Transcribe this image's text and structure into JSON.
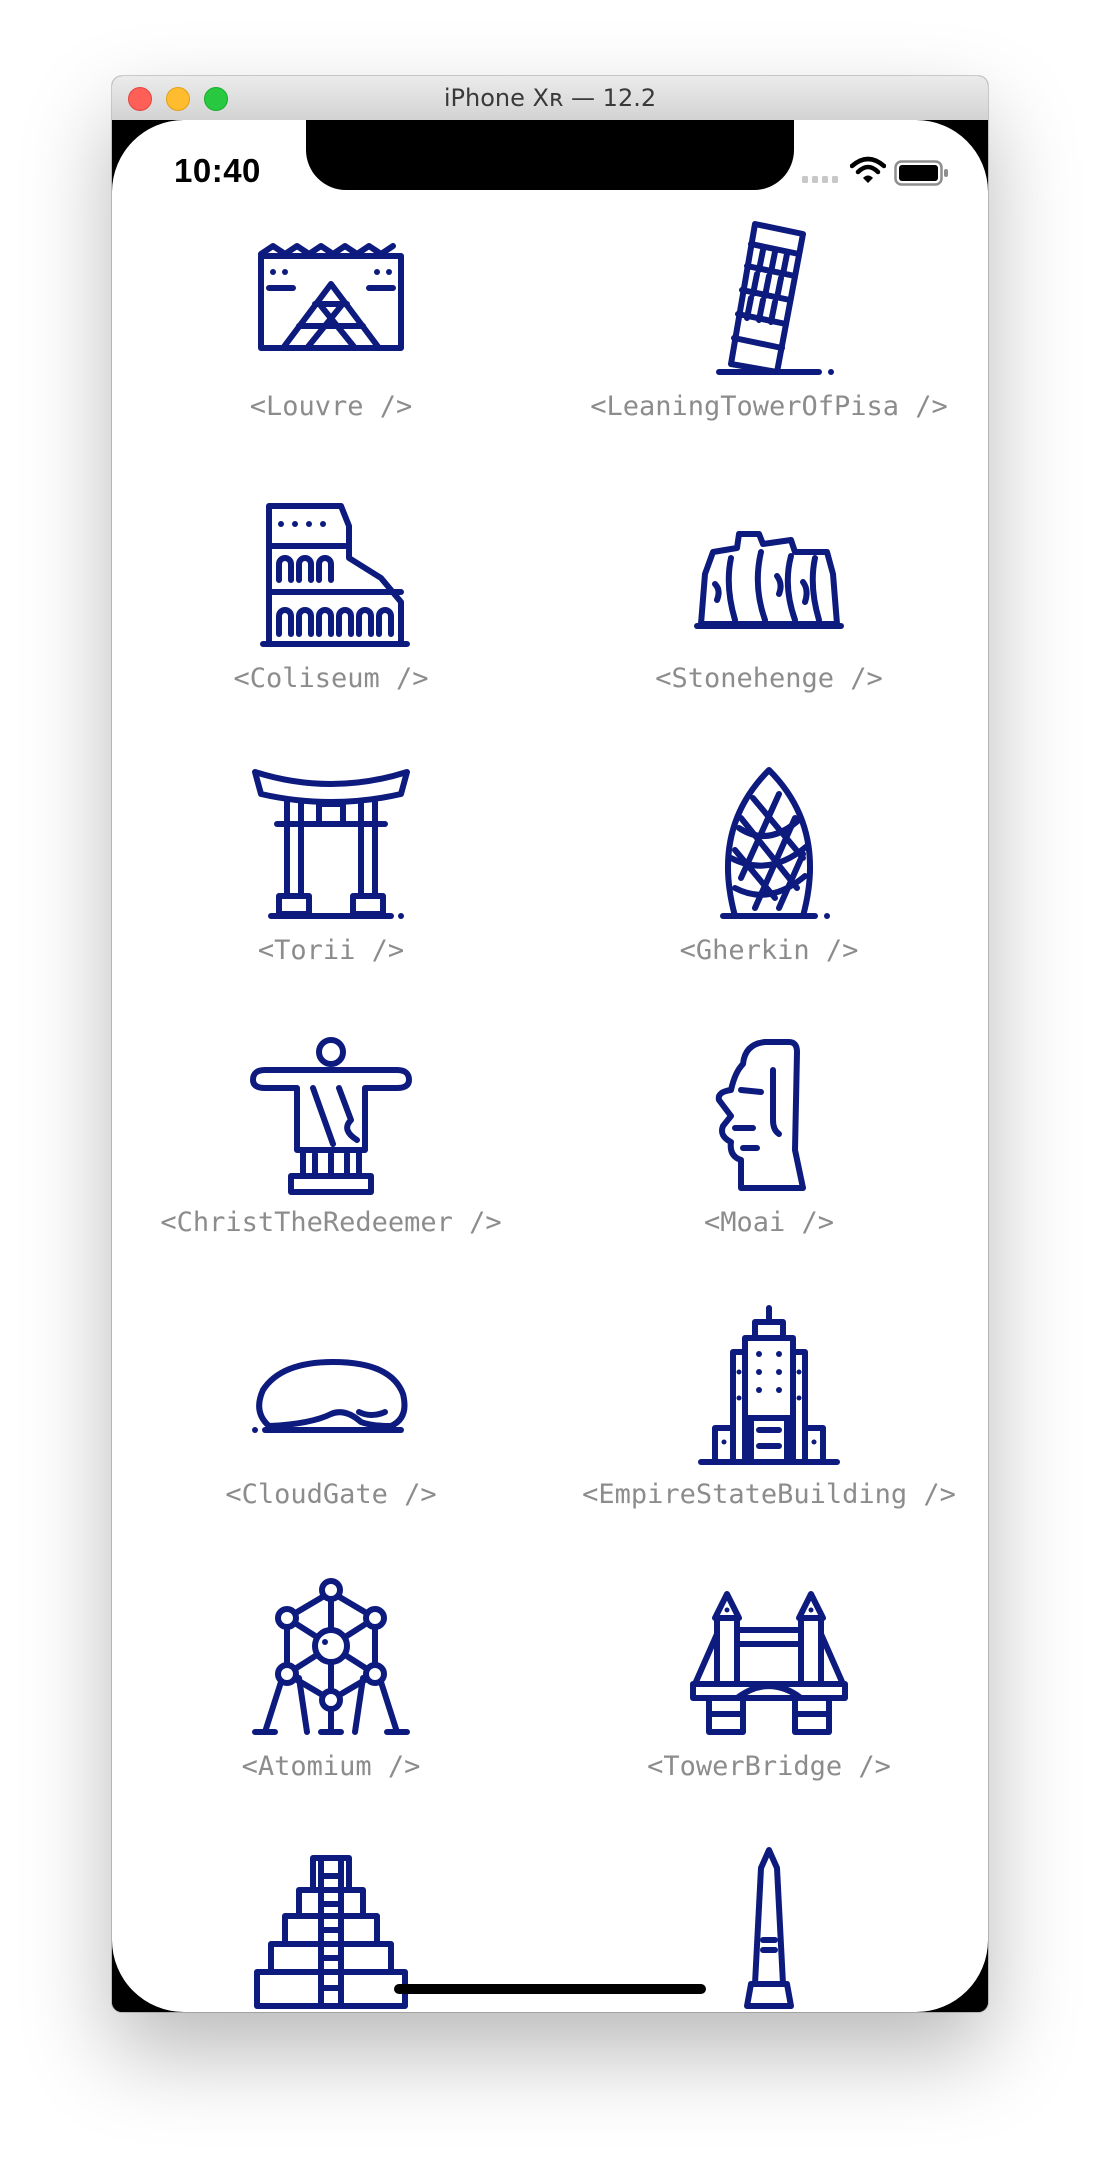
{
  "window": {
    "title": "iPhone Xʀ — 12.2"
  },
  "status_bar": {
    "time": "10:40"
  },
  "icon_color": "#0d1a7e",
  "label_color": "#8c8c8c",
  "landmarks": [
    {
      "label": "<Louvre />",
      "icon": "louvre-icon"
    },
    {
      "label": "<LeaningTowerOfPisa />",
      "icon": "leaning-tower-of-pisa-icon"
    },
    {
      "label": "<Coliseum />",
      "icon": "coliseum-icon"
    },
    {
      "label": "<Stonehenge />",
      "icon": "stonehenge-icon"
    },
    {
      "label": "<Torii />",
      "icon": "torii-icon"
    },
    {
      "label": "<Gherkin />",
      "icon": "gherkin-icon"
    },
    {
      "label": "<ChristTheRedeemer />",
      "icon": "christ-the-redeemer-icon"
    },
    {
      "label": "<Moai />",
      "icon": "moai-icon"
    },
    {
      "label": "<CloudGate />",
      "icon": "cloud-gate-icon"
    },
    {
      "label": "<EmpireStateBuilding />",
      "icon": "empire-state-building-icon"
    },
    {
      "label": "<Atomium />",
      "icon": "atomium-icon"
    },
    {
      "label": "<TowerBridge />",
      "icon": "tower-bridge-icon"
    },
    {
      "label": "",
      "icon": "chichen-itza-pyramid-icon"
    },
    {
      "label": "",
      "icon": "obelisk-icon"
    }
  ]
}
